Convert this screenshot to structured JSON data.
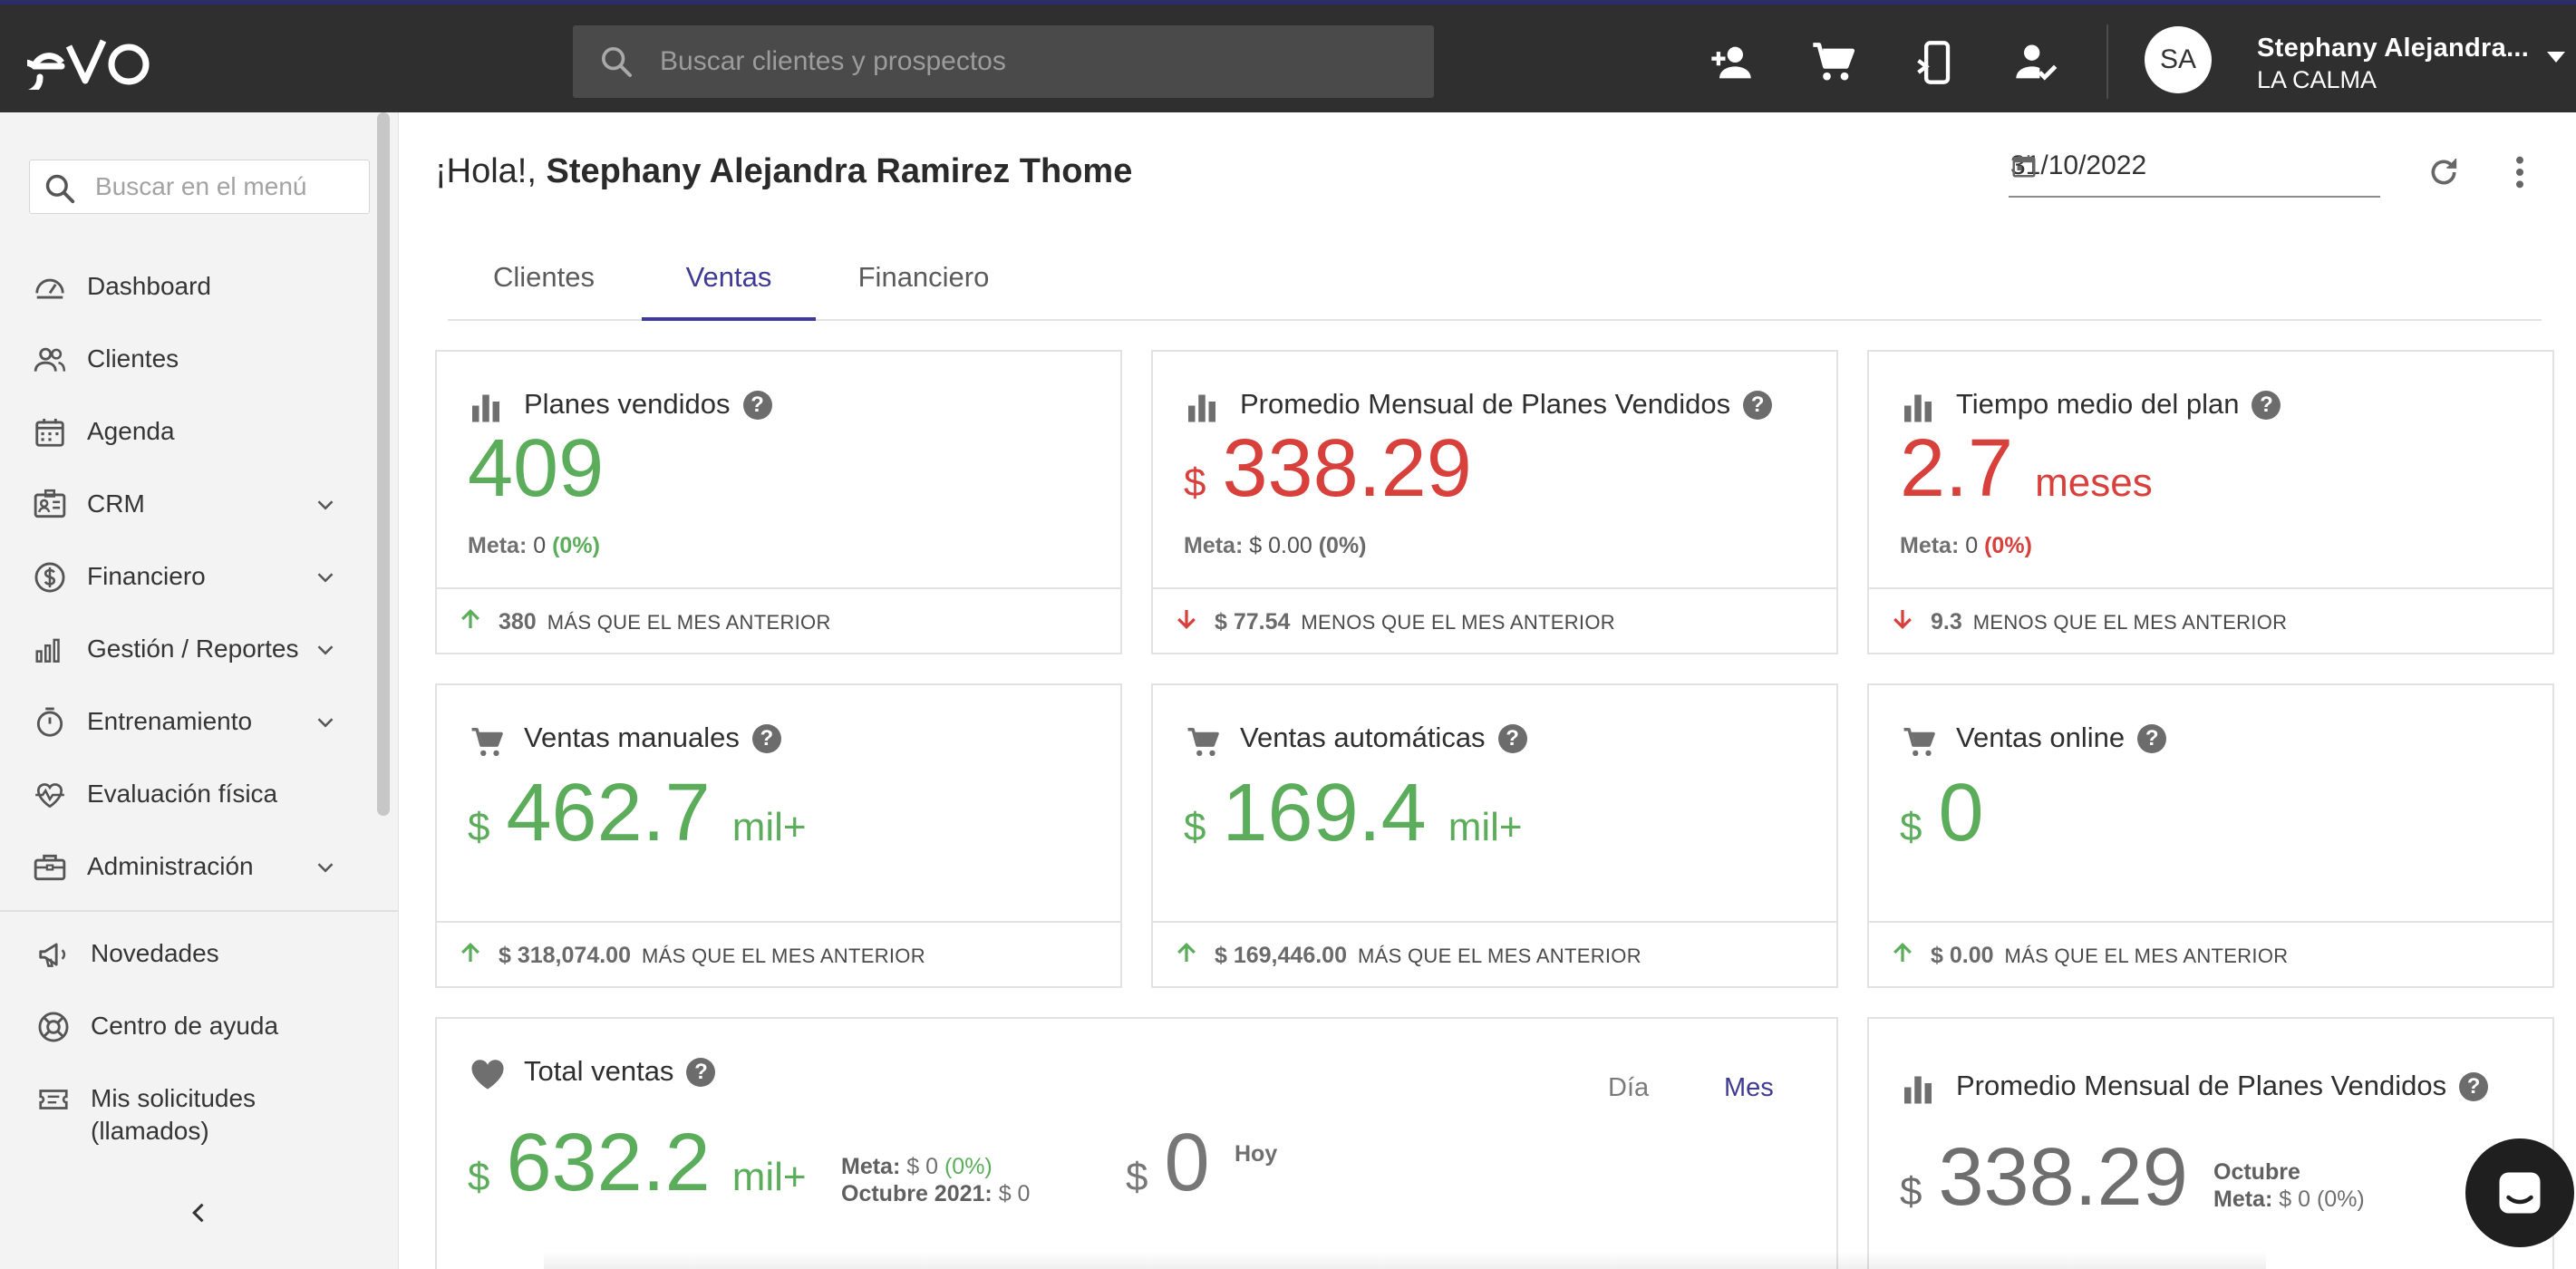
{
  "brand": {
    "logo_text": "evo"
  },
  "header": {
    "search_placeholder": "Buscar clientes y prospectos",
    "user": {
      "initials": "SA",
      "name": "Stephany Alejandra...",
      "unit": "LA CALMA"
    },
    "icons": [
      "add-person-icon",
      "cart-icon",
      "mobile-icon",
      "person-check-icon"
    ]
  },
  "sidebar": {
    "search_placeholder": "Buscar en el menú",
    "items": [
      {
        "label": "Dashboard",
        "icon": "dashboard-icon",
        "has_submenu": false
      },
      {
        "label": "Clientes",
        "icon": "people-icon",
        "has_submenu": false
      },
      {
        "label": "Agenda",
        "icon": "calendar-icon",
        "has_submenu": false
      },
      {
        "label": "CRM",
        "icon": "contact-card-icon",
        "has_submenu": true
      },
      {
        "label": "Financiero",
        "icon": "dollar-icon",
        "has_submenu": true
      },
      {
        "label": "Gestión / Reportes",
        "icon": "bar-chart-icon",
        "has_submenu": true
      },
      {
        "label": "Entrenamiento",
        "icon": "timer-icon",
        "has_submenu": true
      },
      {
        "label": "Evaluación física",
        "icon": "heartbeat-icon",
        "has_submenu": false
      },
      {
        "label": "Administración",
        "icon": "briefcase-icon",
        "has_submenu": true
      }
    ],
    "bottom_items": [
      {
        "label": "Novedades",
        "icon": "megaphone-icon"
      },
      {
        "label": "Centro de ayuda",
        "icon": "lifebuoy-icon"
      },
      {
        "label": "Mis solicitudes",
        "label2": "(llamados)",
        "icon": "ticket-icon"
      }
    ]
  },
  "main": {
    "greeting_prefix": "¡Hola!,",
    "greeting_name": "Stephany Alejandra Ramirez Thome",
    "date": "31/10/2022",
    "tabs": [
      {
        "label": "Clientes",
        "active": false
      },
      {
        "label": "Ventas",
        "active": true
      },
      {
        "label": "Financiero",
        "active": false
      }
    ],
    "cards": {
      "planes": {
        "title": "Planes vendidos",
        "value": "409",
        "meta_label": "Meta:",
        "meta_value": "0",
        "meta_pct": "(0%)",
        "foot_value": "380",
        "foot_text": "MÁS QUE EL MES ANTERIOR",
        "trend": "up"
      },
      "promedio": {
        "title": "Promedio Mensual de Planes Vendidos",
        "currency": "$",
        "value": "338.29",
        "meta_label": "Meta:",
        "meta_value": "$ 0.00",
        "meta_pct": "(0%)",
        "foot_value": "$ 77.54",
        "foot_text": "MENOS QUE EL MES ANTERIOR",
        "trend": "down"
      },
      "tiempo": {
        "title": "Tiempo medio del plan",
        "value": "2.7",
        "suffix": "meses",
        "meta_label": "Meta:",
        "meta_value": "0",
        "meta_pct": "(0%)",
        "foot_value": "9.3",
        "foot_text": "MENOS QUE EL MES ANTERIOR",
        "trend": "down"
      },
      "manuales": {
        "title": "Ventas manuales",
        "currency": "$",
        "value": "462.7",
        "suffix": "mil+",
        "foot_value": "$ 318,074.00",
        "foot_text": "MÁS QUE EL MES ANTERIOR",
        "trend": "up"
      },
      "automaticas": {
        "title": "Ventas automáticas",
        "currency": "$",
        "value": "169.4",
        "suffix": "mil+",
        "foot_value": "$ 169,446.00",
        "foot_text": "MÁS QUE EL MES ANTERIOR",
        "trend": "up"
      },
      "online": {
        "title": "Ventas online",
        "currency": "$",
        "value": "0",
        "foot_value": "$ 0.00",
        "foot_text": "MÁS QUE EL MES ANTERIOR",
        "trend": "up"
      },
      "total": {
        "title": "Total ventas",
        "period_day": "Día",
        "period_month": "Mes",
        "currency": "$",
        "value": "632.2",
        "suffix": "mil+",
        "meta_label": "Meta:",
        "meta_value": "$ 0",
        "meta_pct": "(0%)",
        "prev_label": "Octubre 2021:",
        "prev_value": "$ 0",
        "today_currency": "$",
        "today_value": "0",
        "today_label": "Hoy"
      },
      "promedio2": {
        "title": "Promedio Mensual de Planes Vendidos",
        "currency": "$",
        "value": "338.29",
        "month_label": "Octubre",
        "meta_label": "Meta:",
        "meta_value": "$ 0",
        "meta_pct": "(0%)"
      }
    }
  },
  "colors": {
    "topbar": "#2f2f30",
    "accent": "#3f3a94",
    "positive": "#5cad5b",
    "negative": "#d8403c"
  }
}
